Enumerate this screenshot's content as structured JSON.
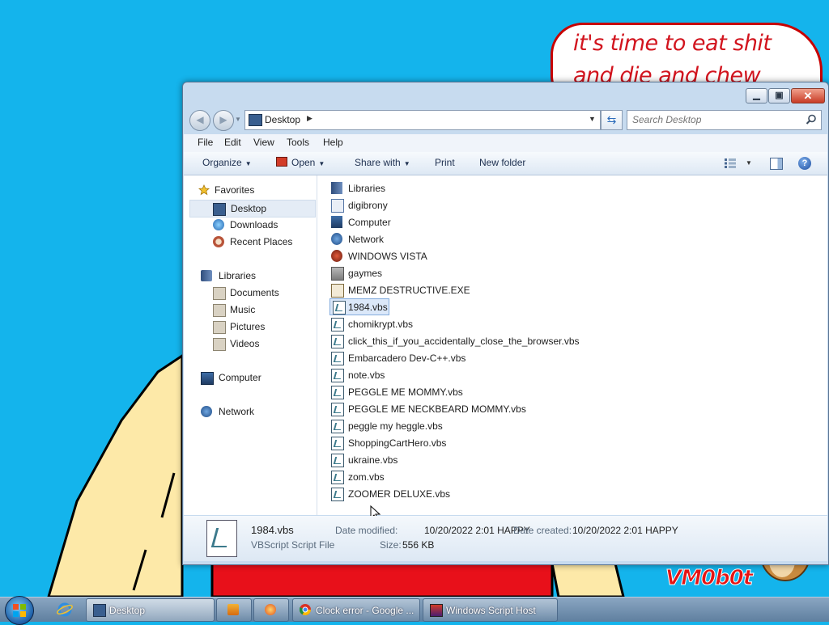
{
  "wallpaper": {
    "meme_line1": "it's time to eat shit",
    "meme_line2": "and die and chew",
    "logo": "VM0b0t"
  },
  "window": {
    "address": {
      "location": "Desktop"
    },
    "search": {
      "placeholder": "Search Desktop"
    },
    "menu": [
      "File",
      "Edit",
      "View",
      "Tools",
      "Help"
    ],
    "commands": {
      "organize": "Organize",
      "open": "Open",
      "share": "Share with",
      "print": "Print",
      "new_folder": "New folder"
    },
    "nav": {
      "favorites": "Favorites",
      "desktop": "Desktop",
      "downloads": "Downloads",
      "recent": "Recent Places",
      "libraries": "Libraries",
      "documents": "Documents",
      "music": "Music",
      "pictures": "Pictures",
      "videos": "Videos",
      "computer": "Computer",
      "network": "Network"
    },
    "files": [
      "Libraries",
      "digibrony",
      "Computer",
      "Network",
      "WINDOWS VISTA",
      "gaymes",
      "MEMZ DESTRUCTIVE.EXE",
      "1984.vbs",
      "chomikrypt.vbs",
      "click_this_if_you_accidentally_close_the_browser.vbs",
      "Embarcadero Dev-C++.vbs",
      "note.vbs",
      "PEGGLE ME MOMMY.vbs",
      "PEGGLE ME NECKBEARD MOMMY.vbs",
      "peggle my heggle.vbs",
      "ShoppingCartHero.vbs",
      "ukraine.vbs",
      "zom.vbs",
      "ZOOMER DELUXE.vbs"
    ],
    "selected_file": "1984.vbs",
    "details": {
      "name": "1984.vbs",
      "type": "VBScript Script File",
      "modified_label": "Date modified:",
      "modified_value": "10/20/2022 2:01 HAPPY",
      "created_label": "Date created:",
      "created_value": "10/20/2022 2:01 HAPPY",
      "size_label": "Size:",
      "size_value": "556 KB"
    }
  },
  "taskbar": {
    "items": [
      "Desktop",
      "Clock error - Google ...",
      "Windows Script Host"
    ]
  },
  "colors": {
    "desktop": "#14b4ec",
    "meme_text": "#d2141e",
    "window_frame": "#c7dbef",
    "selection": "#dbe8f9"
  }
}
